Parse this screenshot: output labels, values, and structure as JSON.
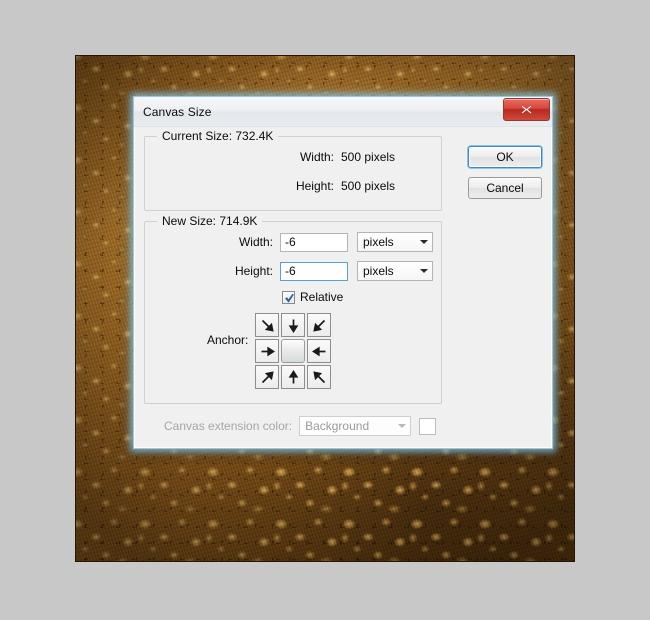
{
  "canvas": {
    "background_color": "#c8c8c8",
    "photo": {
      "description": "brown pebbled leather texture",
      "base_color": "#8d5d1f"
    }
  },
  "dialog": {
    "title": "Canvas Size",
    "close_icon": "close-icon",
    "buttons": {
      "ok": "OK",
      "cancel": "Cancel"
    },
    "current_size": {
      "legend": "Current Size: 732.4K",
      "width_label": "Width:",
      "width_value": "500 pixels",
      "height_label": "Height:",
      "height_value": "500 pixels"
    },
    "new_size": {
      "legend": "New Size: 714.9K",
      "width_label": "Width:",
      "width_value": "-6",
      "width_unit": "pixels",
      "height_label": "Height:",
      "height_value": "-6",
      "height_unit": "pixels",
      "relative_label": "Relative",
      "relative_checked": true,
      "anchor_label": "Anchor:",
      "anchor_selected": "center",
      "anchor_cells": [
        "arrow-down-right",
        "arrow-down",
        "arrow-down-left",
        "arrow-right",
        "anchor-center",
        "arrow-left",
        "arrow-up-right",
        "arrow-up",
        "arrow-up-left"
      ]
    },
    "extension": {
      "label": "Canvas extension color:",
      "value": "Background",
      "swatch_color": "#ffffff",
      "disabled": true
    }
  }
}
